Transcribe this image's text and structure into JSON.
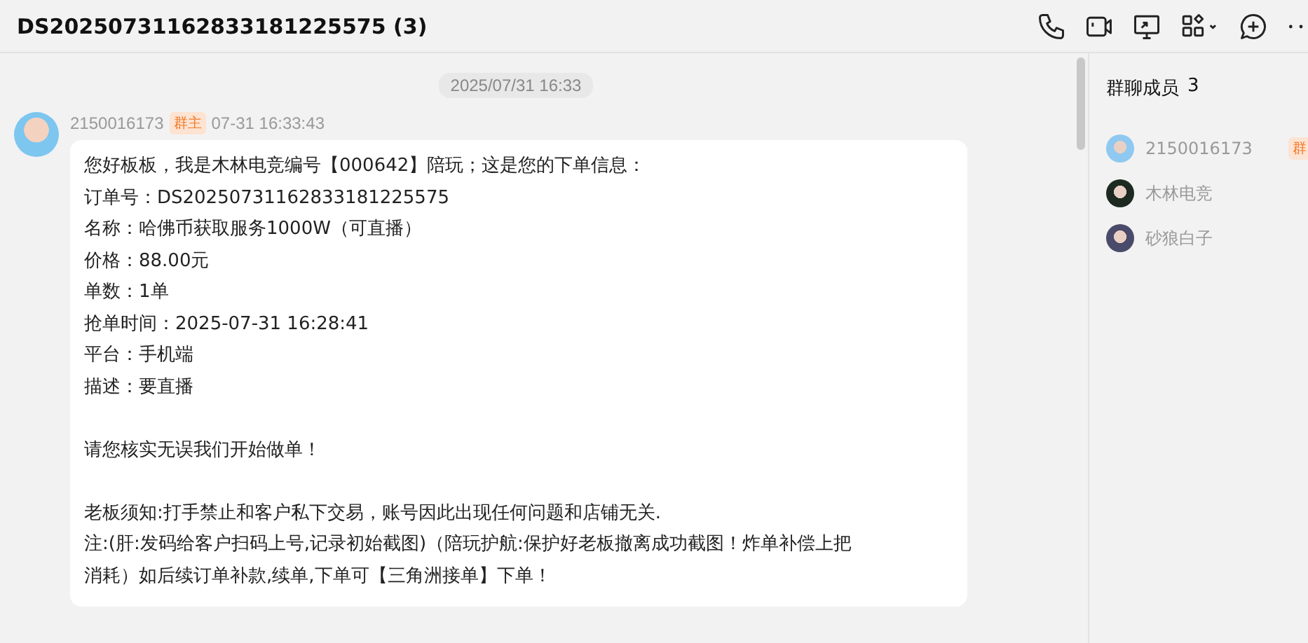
{
  "window": {
    "title": "DS20250731162833181225575 (3)"
  },
  "toolbar": [
    {
      "kind": "phone"
    },
    {
      "kind": "video"
    },
    {
      "kind": "screen"
    },
    {
      "kind": "apps"
    },
    {
      "kind": "add"
    },
    {
      "kind": "more"
    }
  ],
  "chat": {
    "timestamp": "2025/07/31 16:33",
    "messages": [
      {
        "sender": "2150016173",
        "badge": "群主",
        "time": "07-31 16:33:43",
        "paragraphs": [
          [
            "您好板板，我是木林电竞编号【000642】陪玩；这是您的下单信息：",
            "订单号：DS20250731162833181225575",
            "名称：哈佛币获取服务1000W（可直播）",
            "价格：88.00元",
            "单数：1单",
            "抢单时间：2025-07-31 16:28:41",
            "平台：手机端",
            "描述：要直播"
          ],
          [
            "请您核实无误我们开始做单！"
          ],
          [
            "老板须知:打手禁止和客户私下交易，账号因此出现任何问题和店铺无关.",
            "注:(肝:发码给客户扫码上号,记录初始截图)（陪玩护航:保护好老板撤离成功截图！炸单补偿上把消耗）如后续订单补款,续单,下单可【三角洲接单】下单！"
          ]
        ]
      }
    ]
  },
  "members": {
    "title": "群聊成员",
    "count": "3",
    "items": [
      {
        "name": "2150016173",
        "badge": "群"
      },
      {
        "name": "木林电竞"
      },
      {
        "name": "砂狼白子"
      }
    ]
  }
}
